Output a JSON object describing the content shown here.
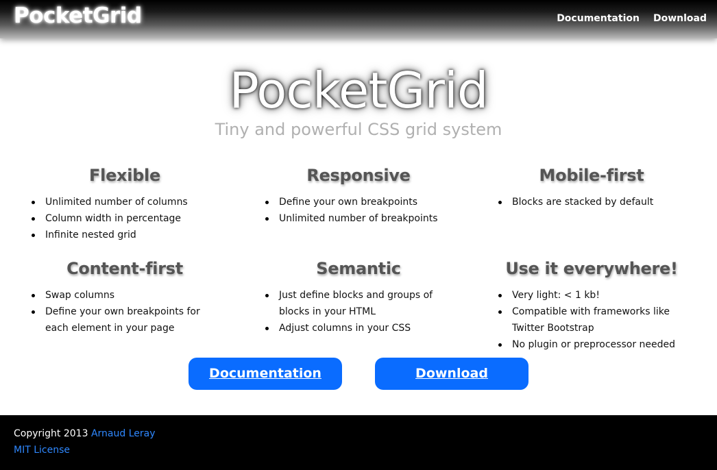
{
  "header": {
    "brand": "PocketGrid",
    "nav": [
      "Documentation",
      "Download"
    ]
  },
  "hero": {
    "title": "PocketGrid",
    "subtitle": "Tiny and powerful CSS grid system"
  },
  "features": [
    {
      "title": "Flexible",
      "items": [
        "Unlimited number of columns",
        "Column width in percentage",
        "Infinite nested grid"
      ]
    },
    {
      "title": "Responsive",
      "items": [
        "Define your own breakpoints",
        "Unlimited number of breakpoints"
      ]
    },
    {
      "title": "Mobile-first",
      "items": [
        "Blocks are stacked by default"
      ]
    },
    {
      "title": "Content-first",
      "items": [
        "Swap columns",
        "Define your own breakpoints for each element in your page"
      ]
    },
    {
      "title": "Semantic",
      "items": [
        "Just define blocks and groups of blocks in your HTML",
        "Adjust columns in your CSS"
      ]
    },
    {
      "title": "Use it everywhere!",
      "items": [
        "Very light: < 1 kb!",
        "Compatible with frameworks like Twitter Bootstrap",
        "No plugin or preprocessor needed"
      ]
    }
  ],
  "actions": {
    "documentation_label": "Documentation",
    "download_label": "Download"
  },
  "footer": {
    "copyright_prefix": "Copyright 2013",
    "author": "Arnaud Leray",
    "license": "MIT License"
  },
  "colors": {
    "accent": "#0a6cff",
    "link": "#2f88ff",
    "footer_bg": "#000000"
  }
}
